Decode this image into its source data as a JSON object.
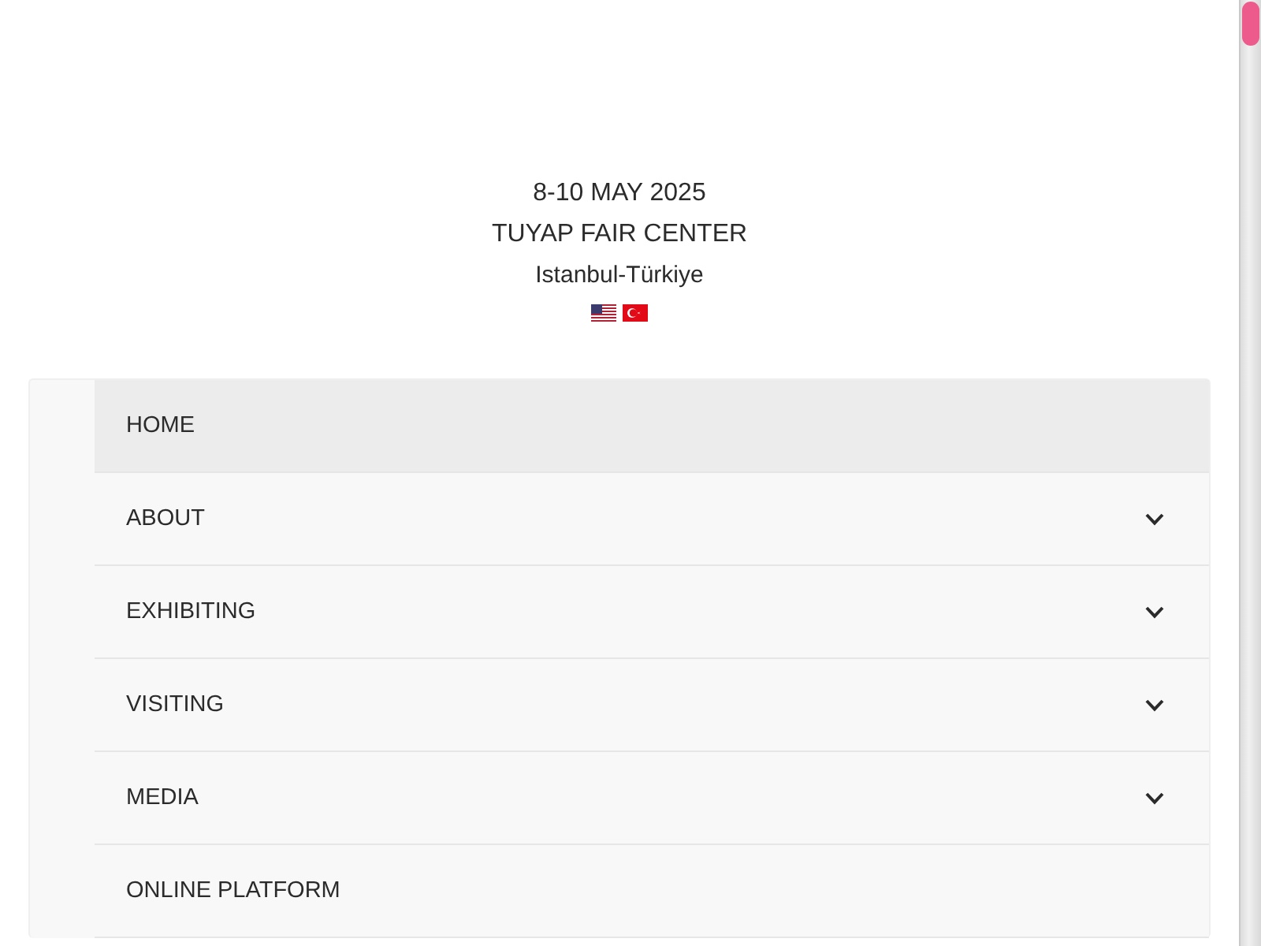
{
  "event": {
    "dates": "8-10 MAY 2025",
    "venue": "TUYAP FAIR CENTER",
    "city": "Istanbul-Türkiye",
    "languages": [
      {
        "kind": "us"
      },
      {
        "kind": "tr"
      }
    ]
  },
  "menu": {
    "items": [
      {
        "label": "HOME",
        "kind": "link",
        "selected": true
      },
      {
        "label": "ABOUT",
        "kind": "submenu",
        "selected": false
      },
      {
        "label": "EXHIBITING",
        "kind": "submenu",
        "selected": false
      },
      {
        "label": "VISITING",
        "kind": "submenu",
        "selected": false
      },
      {
        "label": "MEDIA",
        "kind": "submenu",
        "selected": false
      },
      {
        "label": "ONLINE PLATFORM",
        "kind": "link",
        "selected": false
      }
    ]
  }
}
